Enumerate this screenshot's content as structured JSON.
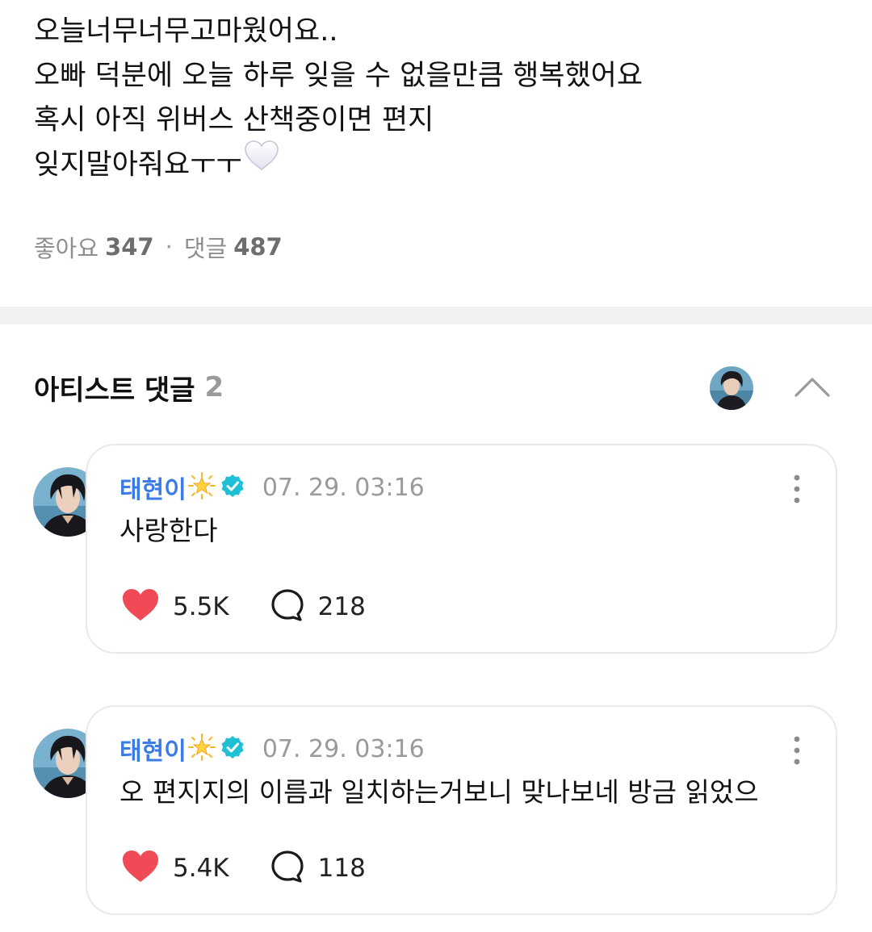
{
  "post": {
    "lines": [
      "오늘너무너무고마웠어요..",
      "오빠 덕분에 오늘 하루 잊을 수 없을만큼 행복했어요",
      "혹시 아직 위버스 산책중이면 편지",
      "잊지말아줘요ㅜㅜ"
    ],
    "trailing_emoji": "white-heart-icon",
    "likes_label": "좋아요",
    "likes_count": "347",
    "separator": "·",
    "comments_label": "댓글",
    "comments_count": "487"
  },
  "artist_comments": {
    "title": "아티스트 댓글",
    "count": "2",
    "items": [
      {
        "author": "태현이",
        "author_emoji": "glowing-star-icon",
        "verified": true,
        "time": "07. 29. 03:16",
        "text": "사랑한다",
        "likes": "5.5K",
        "replies": "218"
      },
      {
        "author": "태현이",
        "author_emoji": "glowing-star-icon",
        "verified": true,
        "time": "07. 29. 03:16",
        "text": "오 편지지의 이름과 일치하는거보니 맞나보네 방금 읽었으",
        "likes": "5.4K",
        "replies": "118"
      }
    ]
  },
  "colors": {
    "author": "#3b7be6",
    "verified": "#1fbfd6",
    "like_heart": "#ef4a55",
    "muted_text": "#9a9a9a",
    "divider": "#f2f2f4",
    "card_border": "#e9e9ec"
  }
}
